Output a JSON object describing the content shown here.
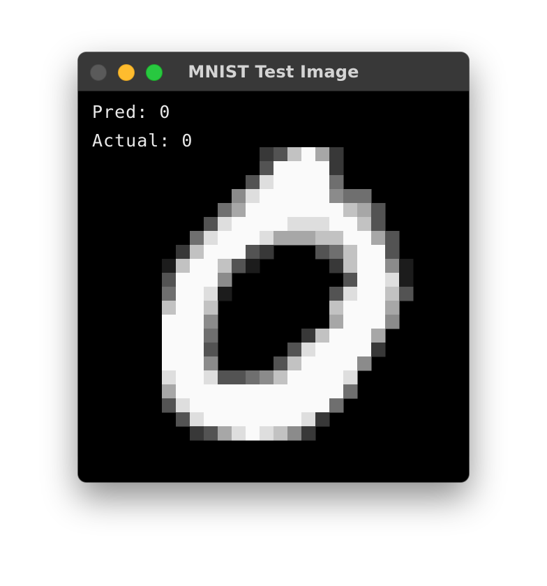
{
  "window": {
    "title": "MNIST Test Image"
  },
  "overlay": {
    "pred_label": "Pred:",
    "pred_value": "0",
    "actual_label": "Actual:",
    "actual_value": "0"
  },
  "image": {
    "grid_size": 28,
    "intensity_rows": [
      "0000000000000000000000000000",
      "0000000000000000000000000000",
      "0000000000000000000000000000",
      "0000000000000000000000000000",
      "0000000000000237962000000000",
      "0000000000000399992000000000",
      "0000000000003899994000000000",
      "0000000000058999995440000000",
      "0000000000469999999763000000",
      "0000000003899998889973000000",
      "0000000048999866677996300000",
      "0000000279993200034799300000",
      "0000001799731000002799510000",
      "0000003999500000000399810000",
      "0000004998100000003899730000",
      "0000007997000000007999600000",
      "0000009995000000006999500000",
      "0000009994000000279996000000",
      "0000009993000003899992000000",
      "0000009995000037999950000000",
      "0000008998334579999800000000",
      "0000006999999999999400000000",
      "0000003899999999994000000000",
      "0000000389999999820000000000",
      "0000000023689875200000000000",
      "0000000000000000000000000000",
      "0000000000000000000000000000",
      "0000000000000000000000000000"
    ]
  }
}
